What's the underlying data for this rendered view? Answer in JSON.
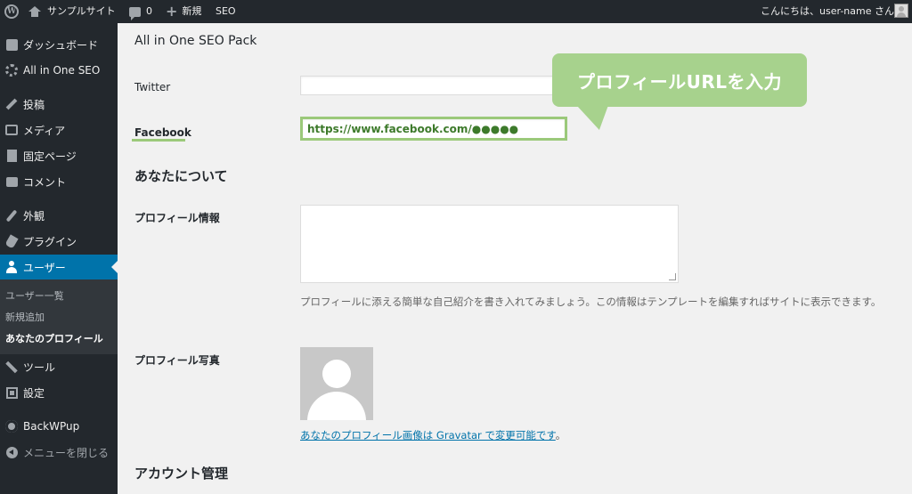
{
  "adminbar": {
    "site_name": "サンプルサイト",
    "comments_count": "0",
    "new_label": "新規",
    "seo_label": "SEO",
    "greeting": "こんにちは、user-name さん"
  },
  "sidebar": {
    "items": [
      {
        "label": "ダッシュボード",
        "icon": "dashboard-icon"
      },
      {
        "label": "All in One SEO",
        "icon": "gear-icon"
      },
      {
        "label": "投稿",
        "icon": "pin-icon"
      },
      {
        "label": "メディア",
        "icon": "media-icon"
      },
      {
        "label": "固定ページ",
        "icon": "page-icon"
      },
      {
        "label": "コメント",
        "icon": "comment-icon"
      },
      {
        "label": "外観",
        "icon": "brush-icon"
      },
      {
        "label": "プラグイン",
        "icon": "plugin-icon"
      },
      {
        "label": "ユーザー",
        "icon": "user-icon"
      },
      {
        "label": "ツール",
        "icon": "wrench-icon"
      },
      {
        "label": "設定",
        "icon": "settings-icon"
      },
      {
        "label": "BackWPup",
        "icon": "backwpup-icon"
      },
      {
        "label": "メニューを閉じる",
        "icon": "collapse-icon"
      }
    ],
    "submenu": [
      "ユーザー一覧",
      "新規追加",
      "あなたのプロフィール"
    ]
  },
  "content": {
    "section_title": "All in One SEO Pack",
    "twitter_label": "Twitter",
    "twitter_value": "",
    "facebook_label": "Facebook",
    "facebook_value": "https://www.facebook.com/●●●●●",
    "about_heading": "あなたについて",
    "bio_label": "プロフィール情報",
    "bio_value": "",
    "bio_description": "プロフィールに添える簡単な自己紹介を書き入れてみましょう。この情報はテンプレートを編集すればサイトに表示できます。",
    "photo_label": "プロフィール写真",
    "gravatar_text": "あなたのプロフィール画像は Gravatar で変更可能です",
    "gravatar_period": "。",
    "account_heading": "アカウント管理"
  },
  "callout": {
    "text": "プロフィールURLを入力",
    "color": "#a7d28d"
  },
  "colors": {
    "admin_dark": "#23282d",
    "active_blue": "#0073aa",
    "highlight_green": "#9bc97a"
  }
}
